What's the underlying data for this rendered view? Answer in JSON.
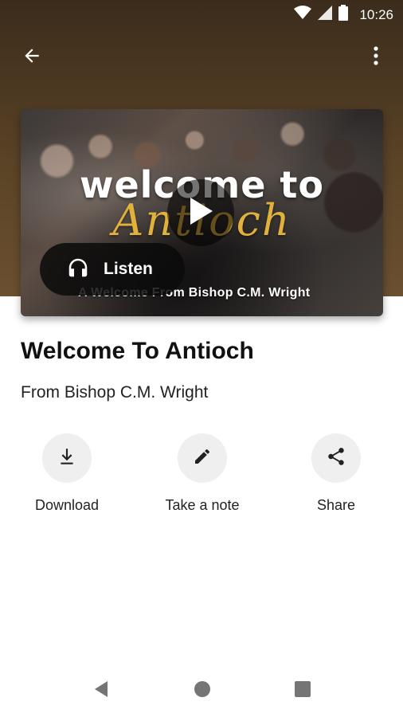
{
  "status_bar": {
    "time": "10:26"
  },
  "app_bar": {
    "back_icon": "arrow-back-icon",
    "menu_icon": "more-vert-icon"
  },
  "video": {
    "title_line1": "welcome to",
    "title_line2": "Antioch",
    "subtitle": "A Welcome From Bishop C.M. Wright",
    "listen_label": "Listen"
  },
  "content": {
    "title": "Welcome To Antioch",
    "subtitle": "From Bishop C.M. Wright"
  },
  "actions": [
    {
      "label": "Download",
      "icon": "download-icon"
    },
    {
      "label": "Take a note",
      "icon": "pencil-icon"
    },
    {
      "label": "Share",
      "icon": "share-icon"
    }
  ],
  "colors": {
    "header": "#5a4326",
    "accent_gold": "#e0b23c",
    "action_circle": "#efefef"
  }
}
